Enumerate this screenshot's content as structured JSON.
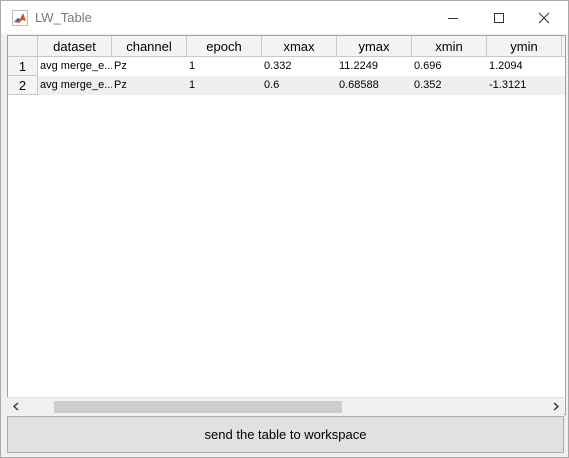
{
  "window": {
    "title": "LW_Table",
    "icon": "matlab-icon"
  },
  "table": {
    "columns": [
      "dataset",
      "channel",
      "epoch",
      "xmax",
      "ymax",
      "xmin",
      "ymin"
    ],
    "rows": [
      {
        "index": "1",
        "cells": [
          "avg merge_e...",
          "Pz",
          "1",
          "0.332",
          "11.2249",
          "0.696",
          "1.2094"
        ]
      },
      {
        "index": "2",
        "cells": [
          "avg merge_e...",
          "Pz",
          "1",
          "0.6",
          "0.68588",
          "0.352",
          "-1.3121"
        ]
      }
    ]
  },
  "send_button": {
    "label": "send the table to workspace"
  }
}
